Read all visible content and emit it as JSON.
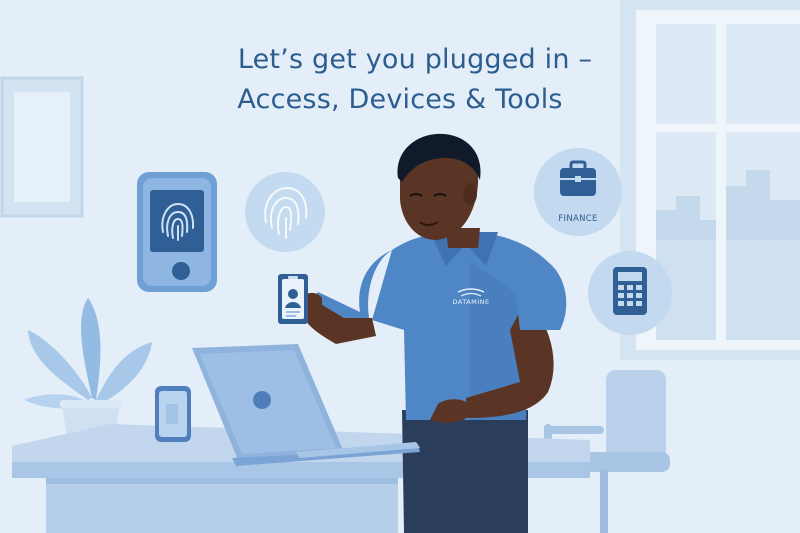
{
  "heading": {
    "line1": "Let’s get you plugged in –",
    "line2": "Access, Devices & Tools"
  },
  "icons": {
    "finance_label": "FINANCE",
    "shirt_logo": "DATAMINE"
  },
  "colors": {
    "background": "#e3eef8",
    "accent": "#2d5d8f",
    "shirt": "#4f86c6",
    "laptop": "#8fb3dd"
  }
}
